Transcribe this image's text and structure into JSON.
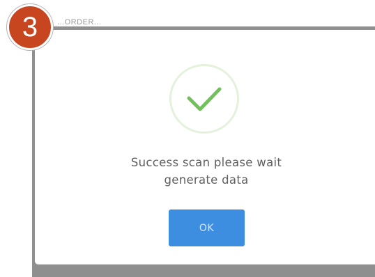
{
  "background": {
    "obscured_text": "...ORDER..."
  },
  "dialog": {
    "icon": "checkmark-icon",
    "message_line1": "Success scan please wait",
    "message_line2": "generate data",
    "ok_label": "OK"
  },
  "step_badge": {
    "number": "3"
  },
  "colors": {
    "badge": "#c8461f",
    "button": "#3d8de0",
    "check": "#72c05b",
    "check_ring": "#e4f2dd",
    "message_text": "#5f5f5f",
    "overlay": "#8f8f8f"
  }
}
